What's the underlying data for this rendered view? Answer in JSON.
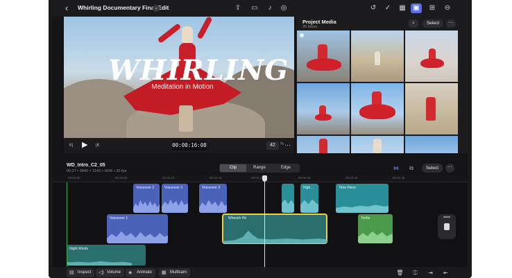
{
  "topbar": {
    "back_icon": "chevron-left-icon",
    "title": "Whirling Documentary Final Edit",
    "title_menu_icon": "chevron-down-icon",
    "center_icons": [
      "export-icon",
      "camera-icon",
      "microphone-icon",
      "navigator-icon"
    ],
    "right_icons": [
      "history-icon",
      "checkmark-icon",
      "grid-icon",
      "media-browser-icon",
      "inspector-icon",
      "more-icon"
    ]
  },
  "viewer": {
    "title_overlay": "WHIRLING",
    "subtitle_overlay": "Meditation in Motion",
    "controls": {
      "skip_back_label": "K|",
      "play_icon": "play-icon",
      "skip_forward_label": "|K",
      "timecode": "00:00:16:08",
      "zoom_value": "42",
      "zoom_unit": "%",
      "more_icon": "ellipsis-icon"
    }
  },
  "media_panel": {
    "title": "Project Media",
    "count": "26 Items",
    "search_icon": "search-icon",
    "select_label": "Select",
    "more_icon": "ellipsis-icon"
  },
  "timeline": {
    "clip_name": "WD_Intro_C2_05",
    "clip_meta": "00:27 • 3840 × 2160 • HDR • 30 fps",
    "segments": [
      "Clip",
      "Range",
      "Edge"
    ],
    "active_segment": "Clip",
    "select_label": "Select",
    "ruler_labels": [
      "00:00:00",
      "00:00:05",
      "00:00:10",
      "00:00:15",
      "00:00:20",
      "00:00:25",
      "00:00:30",
      "00:00:35"
    ],
    "clips": {
      "voiceover2": "Voiceover 2",
      "voiceover3a": "Voiceover 3",
      "voiceover3b": "Voiceover 3",
      "high1": "High…",
      "time_piece": "Time Piece",
      "voiceover1": "Voiceover 1",
      "whoosh": "Whoosh Hit",
      "tortila": "Tortila",
      "night_winds": "Night Winds"
    }
  },
  "bottombar": {
    "inspect": "Inspect",
    "volume": "Volume",
    "animate": "Animate",
    "multicam": "Multicam",
    "right_icons": [
      "trash-icon",
      "split-icon",
      "detach-icon",
      "replace-icon"
    ]
  },
  "colors": {
    "accent": "#5b6ee8",
    "selection": "#f0d23a",
    "audio_blue": "#4a62b8",
    "audio_teal": "#2a8f99",
    "audio_green": "#4b9a4c"
  }
}
